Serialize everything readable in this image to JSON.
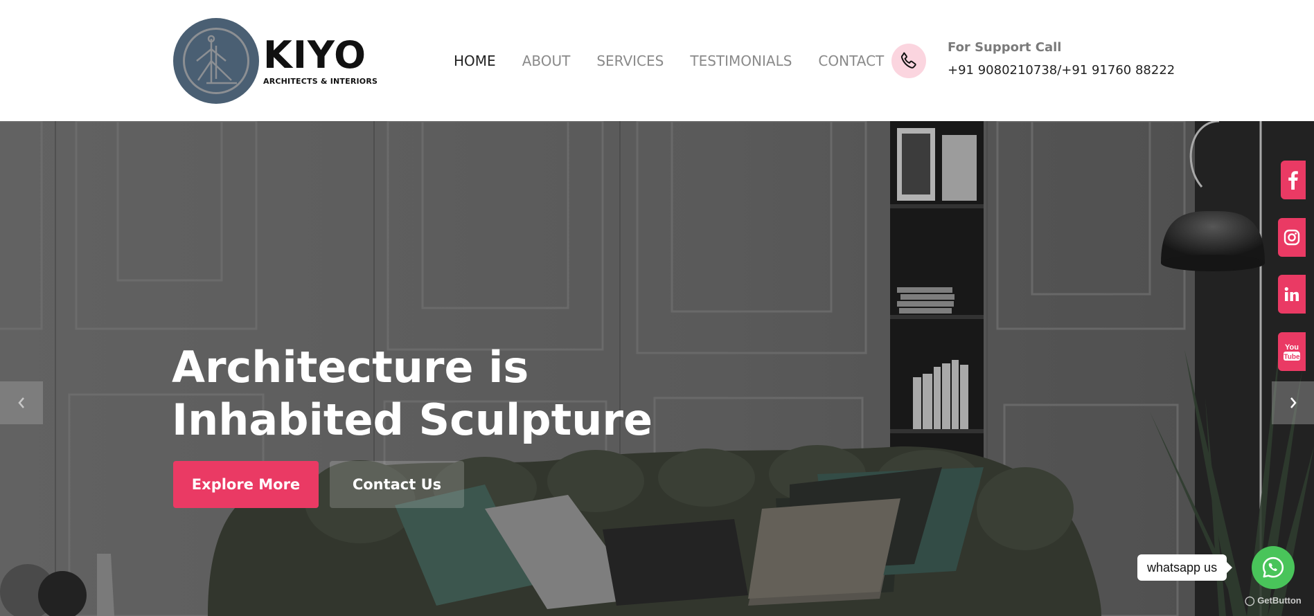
{
  "logo": {
    "title": "KIYO",
    "subtitle": "ARCHITECTS & INTERIORS",
    "color": "#4a5f73"
  },
  "nav": {
    "items": [
      {
        "label": "HOME",
        "active": true
      },
      {
        "label": "ABOUT",
        "active": false
      },
      {
        "label": "SERVICES",
        "active": false
      },
      {
        "label": "TESTIMONIALS",
        "active": false
      },
      {
        "label": "CONTACT",
        "active": false
      }
    ]
  },
  "support": {
    "label": "For Support Call",
    "number": "+91 9080210738/+91 91760 88222",
    "icon": "phone-icon"
  },
  "hero": {
    "title_line1": "Architecture is",
    "title_line2": "Inhabited Sculpture",
    "explore_label": "Explore More",
    "contact_label": "Contact Us",
    "prev_icon": "chevron-left-icon",
    "next_icon": "chevron-right-icon"
  },
  "social": [
    {
      "name": "facebook",
      "icon": "facebook-icon"
    },
    {
      "name": "instagram",
      "icon": "instagram-icon"
    },
    {
      "name": "linkedin",
      "icon": "linkedin-icon"
    },
    {
      "name": "youtube",
      "icon": "youtube-icon",
      "text_top": "You",
      "text_bottom": "Tube"
    }
  ],
  "whatsapp": {
    "label": "whatsapp us",
    "credit": "GetButton"
  },
  "colors": {
    "accent": "#ea3a64",
    "phone_bg": "#fbd5df",
    "whatsapp": "#49c45a"
  }
}
